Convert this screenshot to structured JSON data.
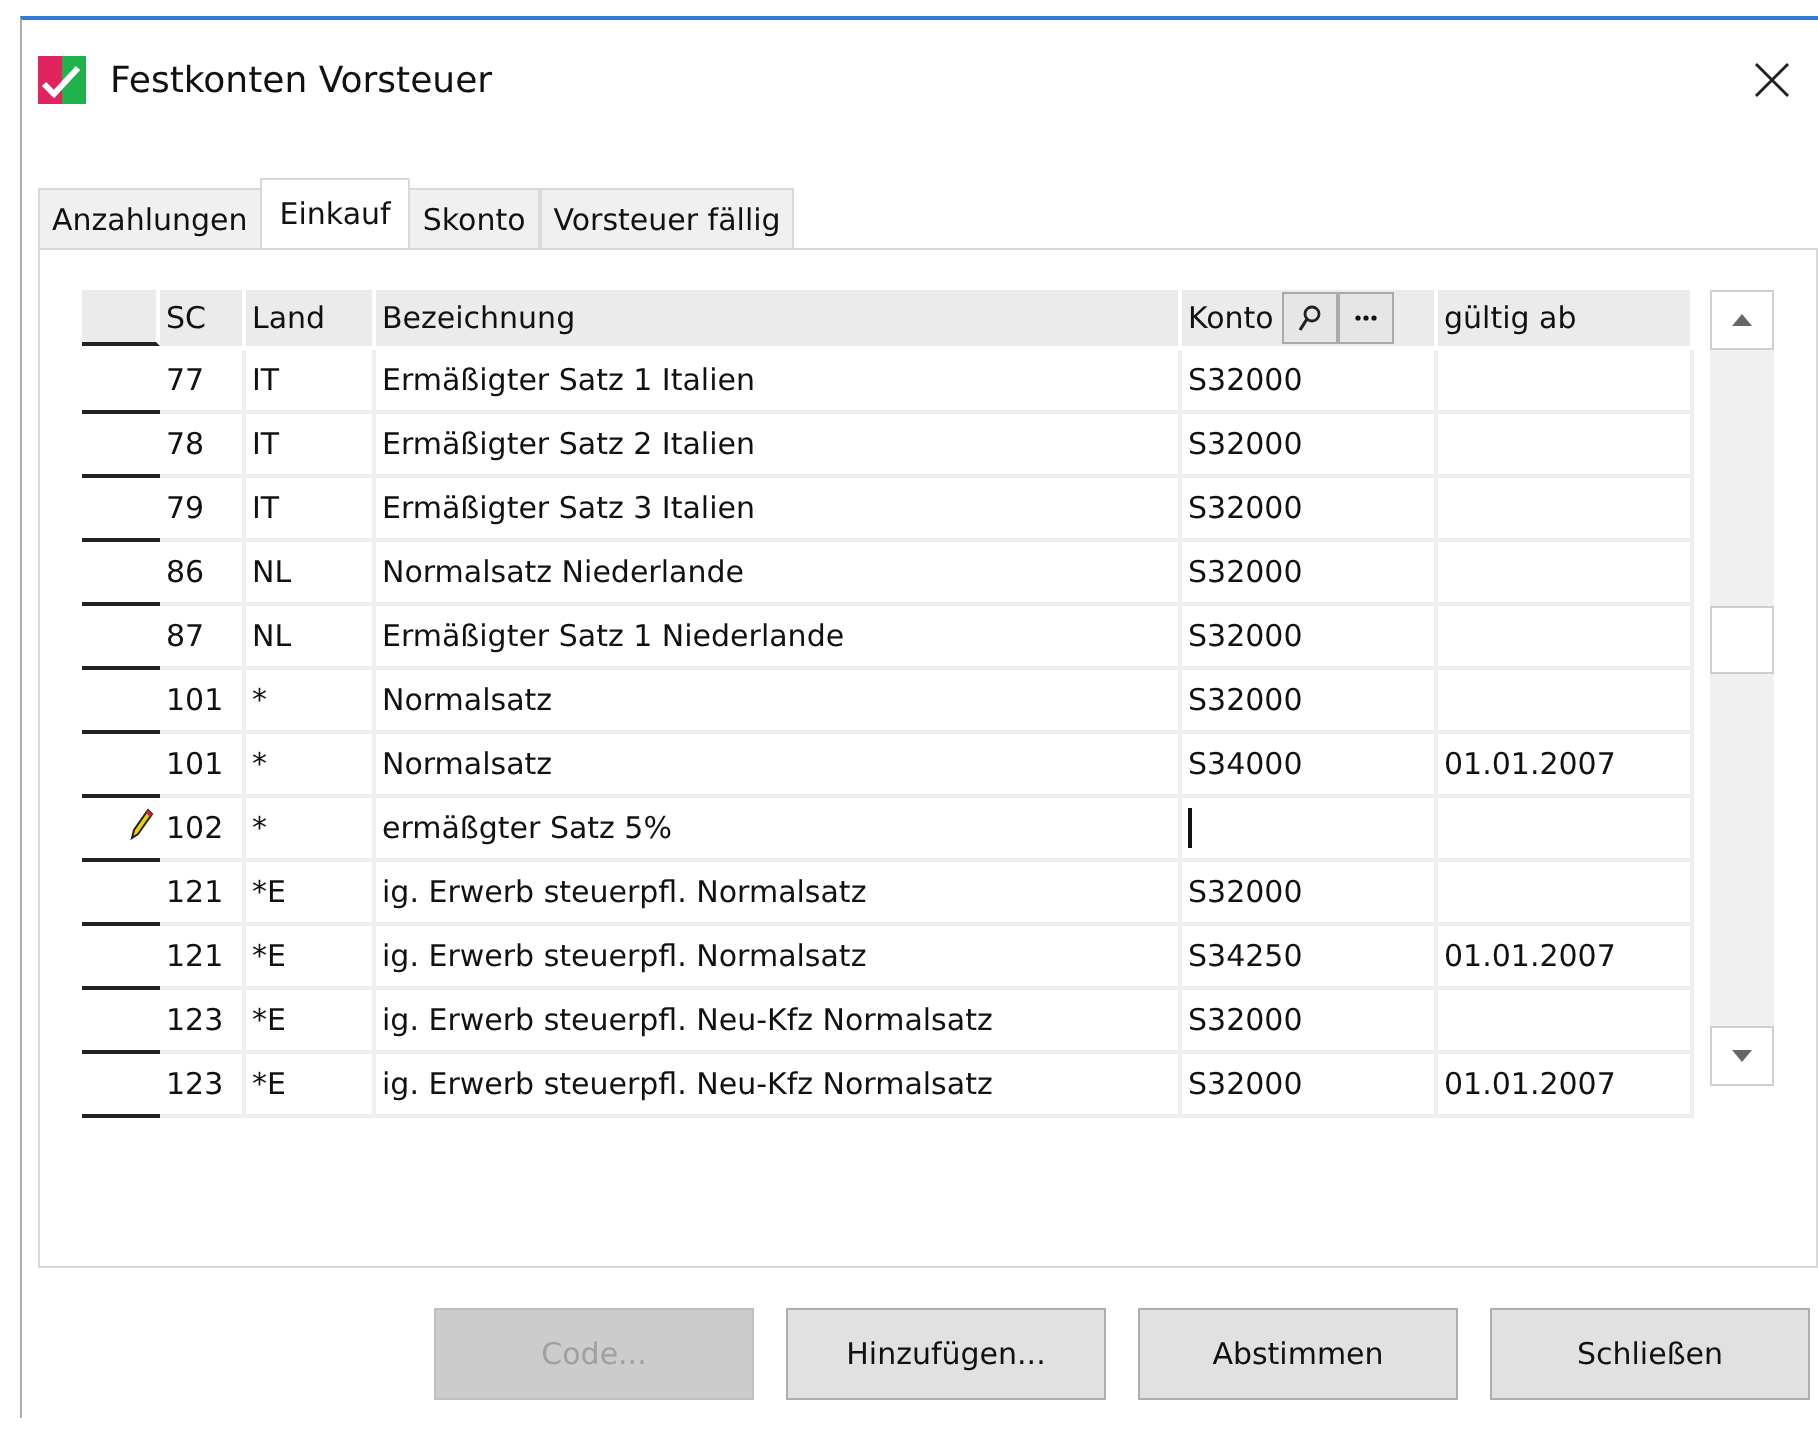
{
  "window": {
    "title": "Festkonten Vorsteuer"
  },
  "tabs": [
    {
      "label": "Anzahlungen",
      "selected": false
    },
    {
      "label": "Einkauf",
      "selected": true
    },
    {
      "label": "Skonto",
      "selected": false
    },
    {
      "label": "Vorsteuer fällig",
      "selected": false
    }
  ],
  "table": {
    "columns": [
      "SC",
      "Land",
      "Bezeichnung",
      "Konto",
      "gültig ab"
    ],
    "rows": [
      {
        "sc": "77",
        "land": "IT",
        "bezeichnung": "Ermäßigter Satz 1 Italien",
        "konto": "S32000",
        "editing": false
      },
      {
        "sc": "78",
        "land": "IT",
        "bezeichnung": "Ermäßigter Satz 2 Italien",
        "konto": "S32000",
        "editing": false
      },
      {
        "sc": "79",
        "land": "IT",
        "bezeichnung": "Ermäßigter Satz 3 Italien",
        "konto": "S32000",
        "editing": false
      },
      {
        "sc": "86",
        "land": "NL",
        "bezeichnung": "Normalsatz Niederlande",
        "konto": "S32000",
        "editing": false
      },
      {
        "sc": "87",
        "land": "NL",
        "bezeichnung": "Ermäßigter Satz 1 Niederlande",
        "konto": "S32000",
        "editing": false
      },
      {
        "sc": "101",
        "land": "*",
        "bezeichnung": "Normalsatz",
        "konto": "S32000",
        "editing": false
      },
      {
        "sc": "101",
        "land": "*",
        "bezeichnung": "Normalsatz",
        "konto": "S34000",
        "gueltig_ab": "01.01.2007",
        "editing": false
      },
      {
        "sc": "102",
        "land": "*",
        "bezeichnung": "ermäßgter Satz 5%",
        "editing": true
      },
      {
        "sc": "121",
        "land": "*E",
        "bezeichnung": "ig. Erwerb steuerpfl. Normalsatz",
        "konto": "S32000",
        "editing": false
      },
      {
        "sc": "121",
        "land": "*E",
        "bezeichnung": "ig. Erwerb steuerpfl. Normalsatz",
        "konto": "S34250",
        "gueltig_ab": "01.01.2007",
        "editing": false
      },
      {
        "sc": "123",
        "land": "*E",
        "bezeichnung": "ig. Erwerb steuerpfl. Neu-Kfz Normalsatz",
        "konto": "S32000",
        "editing": false
      },
      {
        "sc": "123",
        "land": "*E",
        "bezeichnung": "ig. Erwerb steuerpfl. Neu-Kfz Normalsatz",
        "konto": "S32000",
        "gueltig_ab": "01.01.2007",
        "editing": false
      }
    ]
  },
  "buttons": [
    {
      "label": "Code...",
      "disabled": true
    },
    {
      "label": "Hinzufügen...",
      "disabled": false
    },
    {
      "label": "Abstimmen",
      "disabled": false
    },
    {
      "label": "Schließen",
      "disabled": false
    }
  ]
}
